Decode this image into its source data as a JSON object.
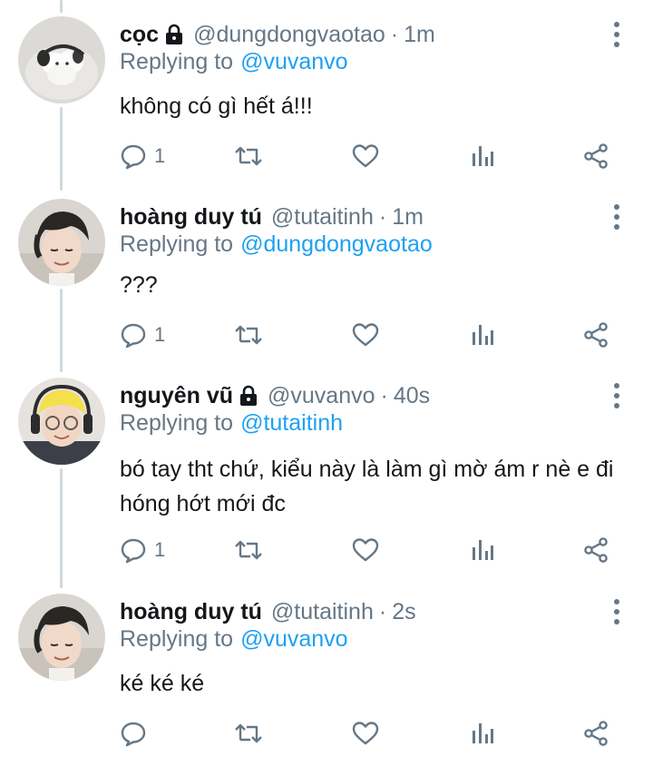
{
  "tweets": [
    {
      "name": "cọc",
      "handle": "@dungdongvaotao",
      "separator": "·",
      "time": "1m",
      "replying_to_label": "Replying to",
      "replying_to": "@vuvanvo",
      "text": "không có gì hết á!!!",
      "reply_count": "1",
      "locked": true
    },
    {
      "name": "hoàng duy tú",
      "handle": "@tutaitinh",
      "separator": "·",
      "time": "1m",
      "replying_to_label": "Replying to",
      "replying_to": "@dungdongvaotao",
      "text": "???",
      "reply_count": "1",
      "locked": false
    },
    {
      "name": "nguyên vũ",
      "handle": "@vuvanvo",
      "separator": "·",
      "time": "40s",
      "replying_to_label": "Replying to",
      "replying_to": "@tutaitinh",
      "text": "bó tay tht chứ, kiểu này là làm gì mờ ám r nè e đi hóng hớt mới đc",
      "reply_count": "1",
      "locked": true
    },
    {
      "name": "hoàng duy tú",
      "handle": "@tutaitinh",
      "separator": "·",
      "time": "2s",
      "replying_to_label": "Replying to",
      "replying_to": "@vuvanvo",
      "text": "ké ké ké",
      "reply_count": "",
      "locked": false
    }
  ],
  "icons": {
    "reply": "reply-icon",
    "retweet": "retweet-icon",
    "like": "heart-icon",
    "analytics": "analytics-icon",
    "share": "share-icon",
    "lock": "lock-icon",
    "more": "more-vertical-icon"
  },
  "colors": {
    "handle_gray": "#657786",
    "mention_blue": "#1da1f2",
    "thread_line": "#cfd9de",
    "text": "#14171a"
  }
}
